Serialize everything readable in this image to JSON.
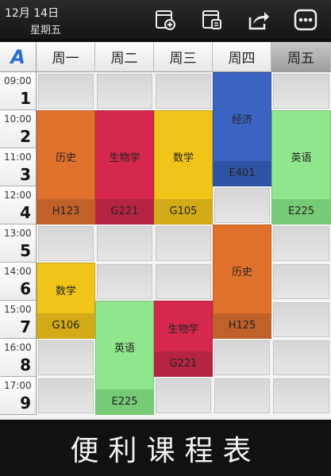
{
  "header": {
    "date": "12月 14日",
    "weekday": "星期五",
    "buttons": [
      {
        "name": "calendar-add-icon"
      },
      {
        "name": "calendar-edit-icon"
      },
      {
        "name": "share-icon"
      },
      {
        "name": "more-icon"
      }
    ]
  },
  "grid": {
    "corner_label": "A",
    "days": [
      "周一",
      "周二",
      "周三",
      "周四",
      "周五"
    ],
    "today_index": 4,
    "periods": [
      {
        "time": "09:00",
        "num": "1"
      },
      {
        "time": "10:00",
        "num": "2"
      },
      {
        "time": "11:00",
        "num": "3"
      },
      {
        "time": "12:00",
        "num": "4"
      },
      {
        "time": "13:00",
        "num": "5"
      },
      {
        "time": "14:00",
        "num": "6"
      },
      {
        "time": "15:00",
        "num": "7"
      },
      {
        "time": "16:00",
        "num": "8"
      },
      {
        "time": "17:00",
        "num": "9"
      }
    ],
    "courses": [
      {
        "day": 0,
        "start": 2,
        "end": 4,
        "name": "历史",
        "room": "H123",
        "color": "#E0722E",
        "room_color": "#C0612A"
      },
      {
        "day": 1,
        "start": 2,
        "end": 4,
        "name": "生物学",
        "room": "G221",
        "color": "#D6284D",
        "room_color": "#B62444"
      },
      {
        "day": 2,
        "start": 2,
        "end": 4,
        "name": "数学",
        "room": "G105",
        "color": "#F0C419",
        "room_color": "#D3AA18"
      },
      {
        "day": 3,
        "start": 1,
        "end": 3,
        "name": "经济",
        "room": "E401",
        "color": "#3A63C2",
        "room_color": "#2F53A4"
      },
      {
        "day": 4,
        "start": 2,
        "end": 4,
        "name": "英语",
        "room": "E225",
        "color": "#90E68C",
        "room_color": "#78CB76"
      },
      {
        "day": 0,
        "start": 6,
        "end": 7,
        "name": "数学",
        "room": "G106",
        "color": "#F0C419",
        "room_color": "#D3AA18"
      },
      {
        "day": 1,
        "start": 7,
        "end": 9,
        "name": "英语",
        "room": "E225",
        "color": "#90E68C",
        "room_color": "#78CB76"
      },
      {
        "day": 2,
        "start": 7,
        "end": 8,
        "name": "生物学",
        "room": "G221",
        "color": "#D6284D",
        "room_color": "#B62444"
      },
      {
        "day": 3,
        "start": 5,
        "end": 7,
        "name": "历史",
        "room": "H125",
        "color": "#E0722E",
        "room_color": "#C0612A"
      }
    ]
  },
  "footer": {
    "title": "便利课程表"
  }
}
